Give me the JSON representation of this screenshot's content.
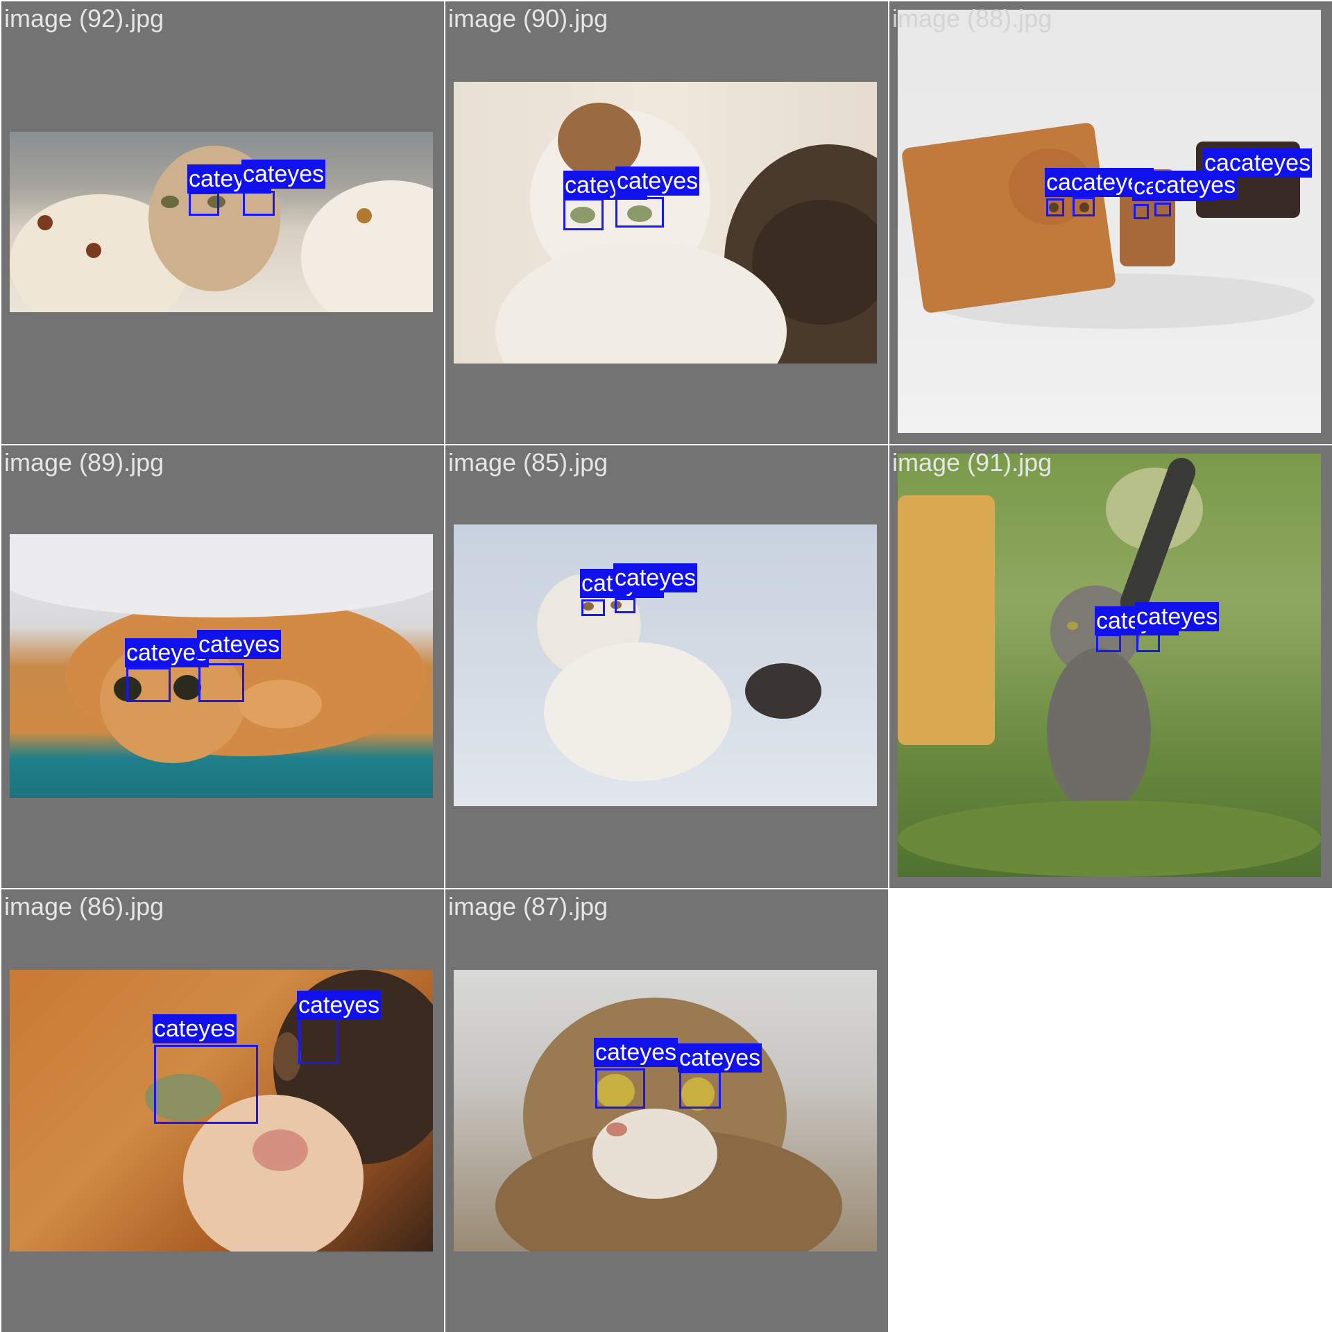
{
  "tiles": [
    {
      "label": "image (92).jpg",
      "label_color": "#e6e6e6",
      "detections": [
        "cateyes",
        "cateyes"
      ]
    },
    {
      "label": "image (90).jpg",
      "label_color": "#e6e6e6",
      "detections": [
        "cateyes",
        "cateyes"
      ]
    },
    {
      "label": "image (88).jpg",
      "label_color": "#d4d4d4",
      "detections": [
        "cacateyes",
        "cateyes",
        "cateyes",
        "cacateyes"
      ]
    },
    {
      "label": "image (89).jpg",
      "label_color": "#e6e6e6",
      "detections": [
        "cateyes",
        "cateyes"
      ]
    },
    {
      "label": "image (85).jpg",
      "label_color": "#e6e6e6",
      "detections": [
        "cateyes",
        "cateyes"
      ]
    },
    {
      "label": "image (91).jpg",
      "label_color": "#e6e6e6",
      "detections": [
        "cateyes",
        "cateyes"
      ]
    },
    {
      "label": "image (86).jpg",
      "label_color": "#e6e6e6",
      "detections": [
        "cateyes",
        "cateyes"
      ]
    },
    {
      "label": "image (87).jpg",
      "label_color": "#e6e6e6",
      "detections": [
        "cateyes",
        "cateyes"
      ]
    }
  ],
  "colors": {
    "tile_background": "#737373",
    "box_color": "#1616ff",
    "tag_background": "#1111ee",
    "tag_text": "#ffffff"
  }
}
